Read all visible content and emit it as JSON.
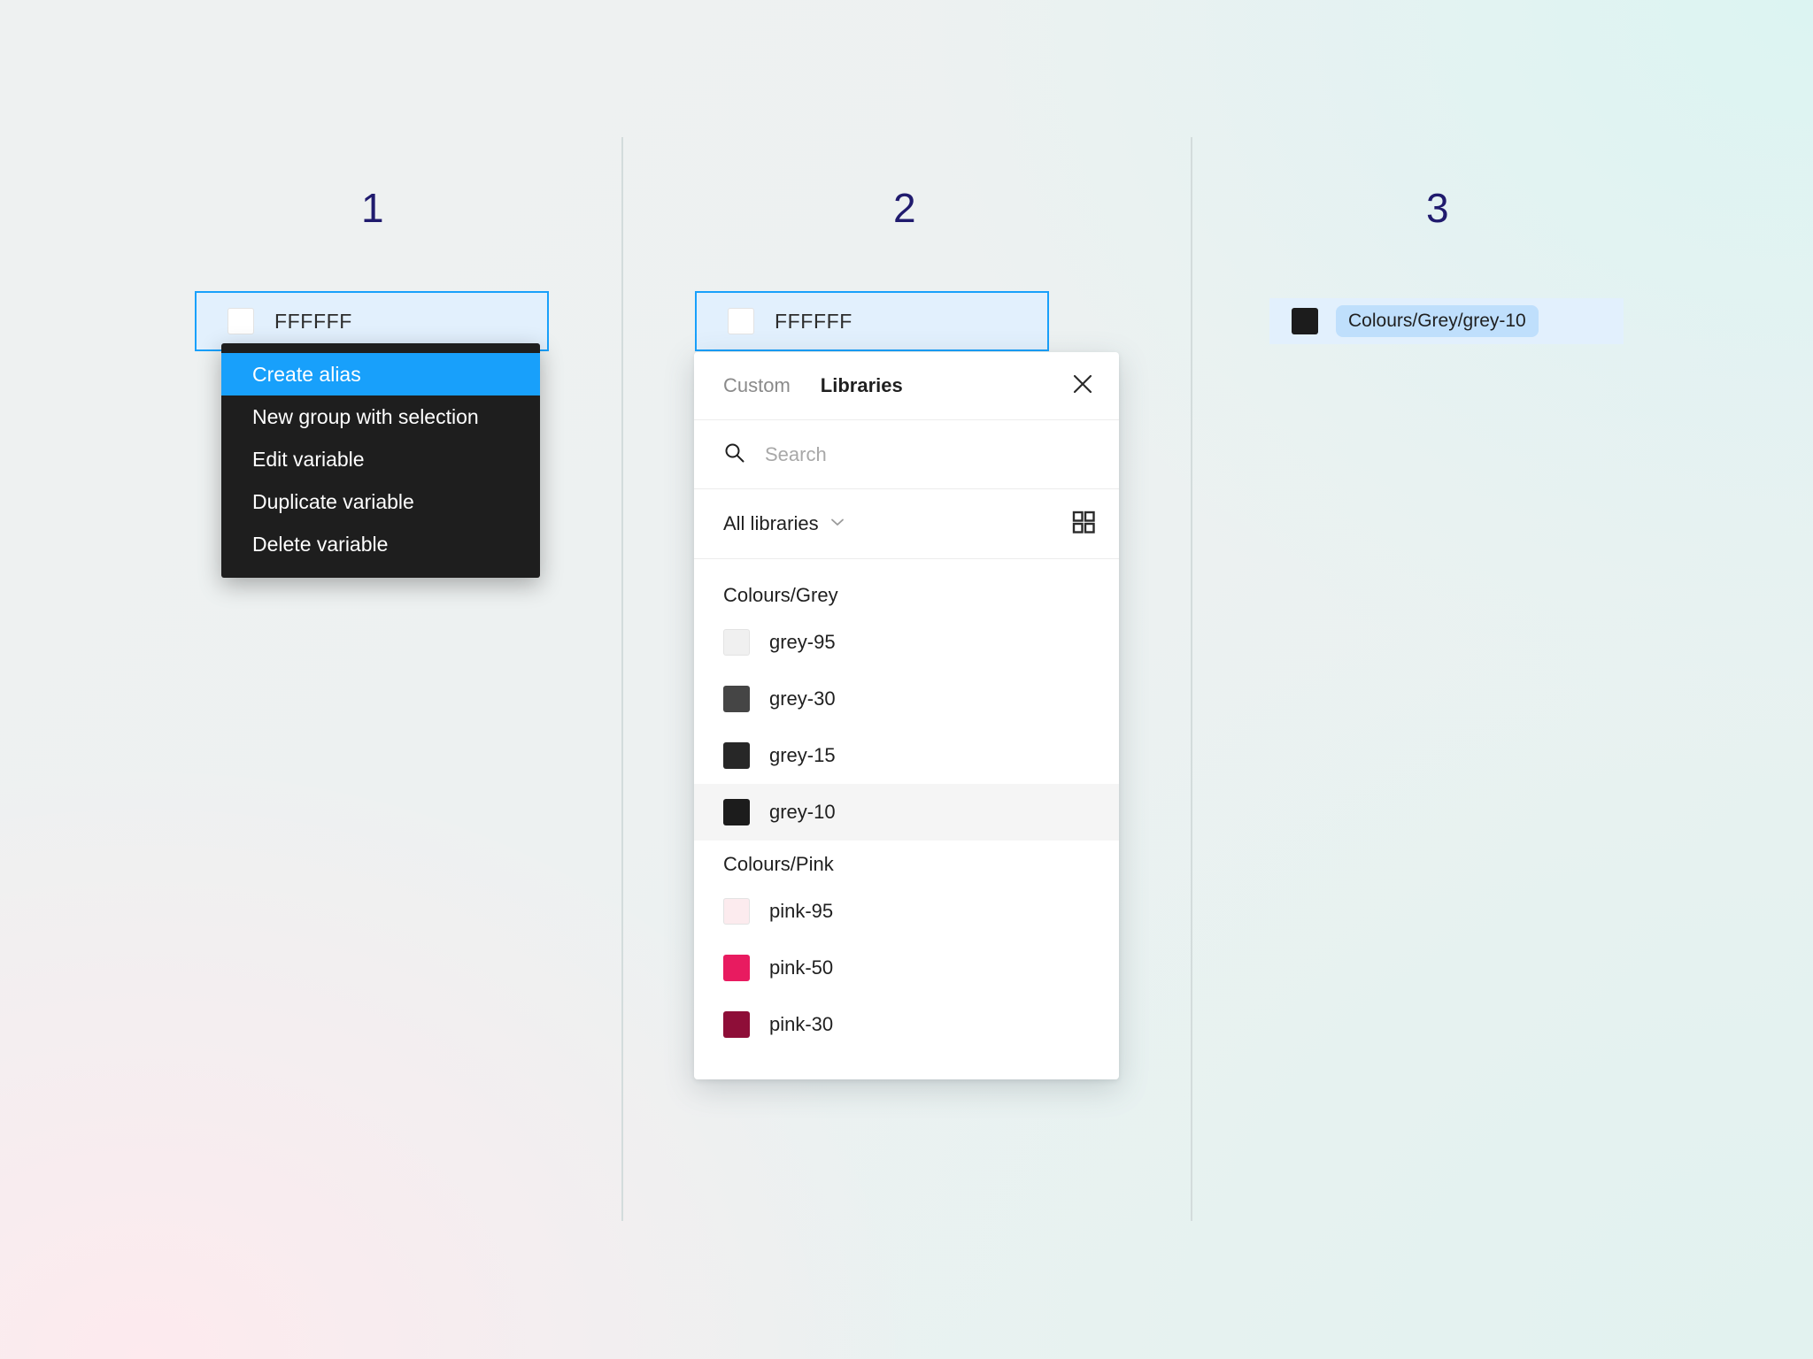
{
  "background": {
    "gradient_top_right": "#DCF4F2",
    "gradient_bottom_left": "#FDEAEE",
    "base": "#EEF1F1"
  },
  "steps": [
    {
      "number": "1"
    },
    {
      "number": "2"
    },
    {
      "number": "3"
    }
  ],
  "step1": {
    "variable_row": {
      "swatch_color": "#FFFFFF",
      "value": "FFFFFF",
      "border_color": "#18A0FB",
      "background_color": "#E2F0FD"
    },
    "context_menu": {
      "items": [
        {
          "label": "Create alias",
          "selected": true
        },
        {
          "label": "New group with selection",
          "selected": false
        },
        {
          "label": "Edit variable",
          "selected": false
        },
        {
          "label": "Duplicate variable",
          "selected": false
        },
        {
          "label": "Delete variable",
          "selected": false
        }
      ],
      "selected_color": "#18A0FB",
      "background_color": "#1E1E1E"
    }
  },
  "step2": {
    "variable_row": {
      "swatch_color": "#FFFFFF",
      "value": "FFFFFF"
    },
    "panel": {
      "tabs": [
        {
          "label": "Custom",
          "active": false
        },
        {
          "label": "Libraries",
          "active": true
        }
      ],
      "close_icon": "close-icon",
      "search": {
        "icon": "search-icon",
        "placeholder": "Search",
        "value": ""
      },
      "filter": {
        "label": "All libraries",
        "chevron_icon": "chevron-down-icon",
        "grid_view_icon": "grid-view-icon"
      },
      "groups": [
        {
          "title": "Colours/Grey",
          "colors": [
            {
              "name": "grey-95",
              "hex": "#F0F0F0",
              "hovered": false
            },
            {
              "name": "grey-30",
              "hex": "#454545",
              "hovered": false
            },
            {
              "name": "grey-15",
              "hex": "#272727",
              "hovered": false
            },
            {
              "name": "grey-10",
              "hex": "#1C1C1C",
              "hovered": true
            }
          ]
        },
        {
          "title": "Colours/Pink",
          "colors": [
            {
              "name": "pink-95",
              "hex": "#FCEBEE",
              "hovered": false
            },
            {
              "name": "pink-50",
              "hex": "#E81B60",
              "hovered": false
            },
            {
              "name": "pink-30",
              "hex": "#8E0E38",
              "hovered": false
            }
          ]
        }
      ]
    }
  },
  "step3": {
    "alias_row": {
      "swatch_color": "#1C1C1C",
      "alias_label": "Colours/Grey/grey-10",
      "chip_background": "#BFDFFC",
      "row_background": "#E2F0FD"
    }
  }
}
